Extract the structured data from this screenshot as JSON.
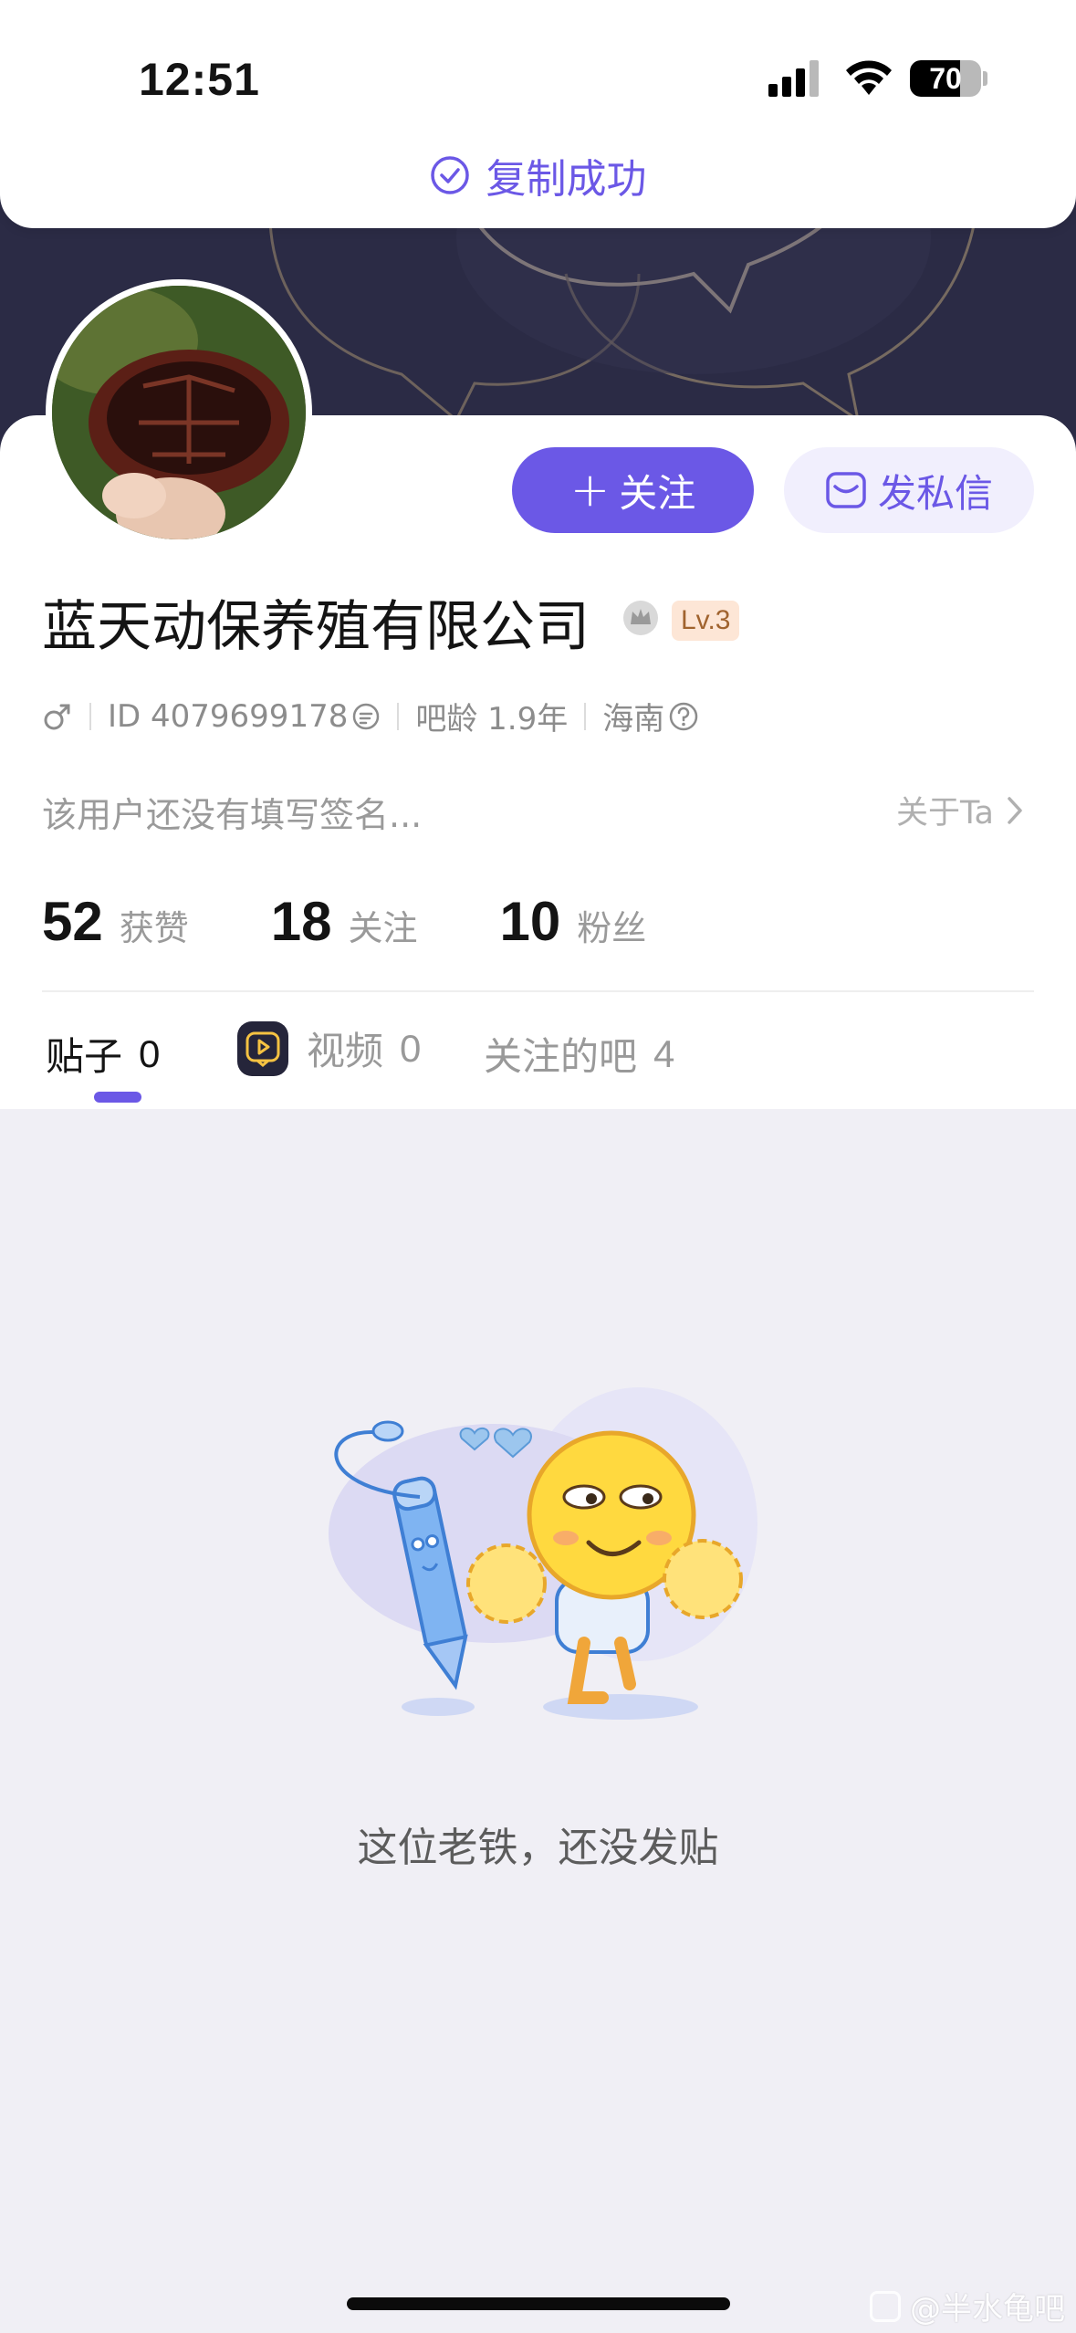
{
  "status_bar": {
    "time": "12:51",
    "battery": "70",
    "battery_level": 0.7
  },
  "toast": {
    "text": "复制成功",
    "icon": "check-circle-icon"
  },
  "profile": {
    "name": "蓝天动保养殖有限公司",
    "level": "Lv.3",
    "gender_icon": "male-icon",
    "id_text": "ID 4079699178",
    "bar_age": "吧龄 1.9年",
    "location": "海南",
    "bio": "该用户还没有填写签名...",
    "about_link": "关于Ta"
  },
  "actions": {
    "follow_label": "关注",
    "message_label": "发私信"
  },
  "stats": [
    {
      "num": "52",
      "label": "获赞"
    },
    {
      "num": "18",
      "label": "关注"
    },
    {
      "num": "10",
      "label": "粉丝"
    }
  ],
  "tabs": [
    {
      "label": "贴子",
      "count": "0"
    },
    {
      "label": "视频",
      "count": "0"
    },
    {
      "label": "关注的吧",
      "count": "4"
    }
  ],
  "empty_state": {
    "text": "这位老铁，还没发贴"
  },
  "watermark": "@半水龟吧",
  "colors": {
    "accent": "#6b58e6",
    "banner": "#2b2b45",
    "background": "#f0eff5"
  }
}
